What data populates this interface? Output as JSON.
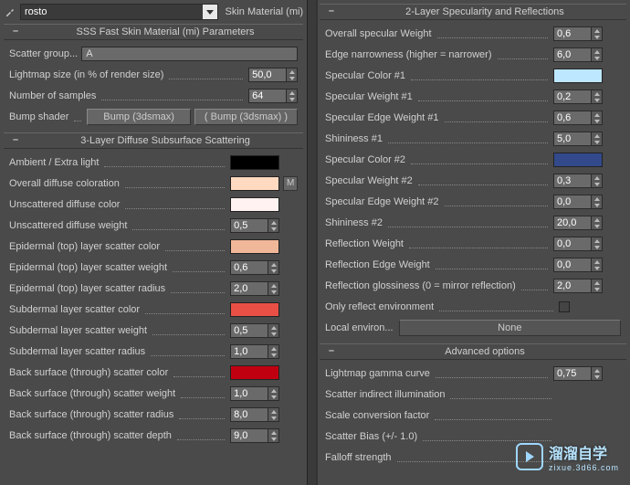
{
  "top": {
    "material_name": "rosto",
    "type_label": "Skin Material (mi)"
  },
  "section1": {
    "title": "SSS Fast Skin Material (mi) Parameters",
    "scatter_group_label": "Scatter group...",
    "scatter_group_value": "A",
    "lightmap_label": "Lightmap size (in % of render size)",
    "lightmap_value": "50,0",
    "samples_label": "Number of samples",
    "samples_value": "64",
    "bump_label": "Bump shader",
    "bump_btn1": "Bump (3dsmax)",
    "bump_btn2": "( Bump (3dsmax) )"
  },
  "section2": {
    "title": "3-Layer Diffuse Subsurface Scattering",
    "ambient_label": "Ambient / Extra light",
    "ambient_color": "#000000",
    "overall_label": "Overall diffuse coloration",
    "overall_color": "#ffd9c0",
    "m_label": "M",
    "unscat_color_label": "Unscattered diffuse color",
    "unscat_color": "#fff2f0",
    "unscat_weight_label": "Unscattered diffuse weight",
    "unscat_weight_value": "0,5",
    "epi_color_label": "Epidermal (top) layer scatter color",
    "epi_color": "#f0b898",
    "epi_weight_label": "Epidermal (top) layer scatter weight",
    "epi_weight_value": "0,6",
    "epi_radius_label": "Epidermal (top) layer scatter radius",
    "epi_radius_value": "2,0",
    "sub_color_label": "Subdermal layer scatter color",
    "sub_color": "#e85045",
    "sub_weight_label": "Subdermal layer scatter weight",
    "sub_weight_value": "0,5",
    "sub_radius_label": "Subdermal layer scatter radius",
    "sub_radius_value": "1,0",
    "back_color_label": "Back surface (through) scatter color",
    "back_color": "#c00010",
    "back_weight_label": "Back surface (through) scatter weight",
    "back_weight_value": "1,0",
    "back_radius_label": "Back surface (through) scatter radius",
    "back_radius_value": "8,0",
    "back_depth_label": "Back surface (through) scatter depth",
    "back_depth_value": "9,0"
  },
  "section3": {
    "title": "2-Layer Specularity and Reflections",
    "spec_weight_label": "Overall specular Weight",
    "spec_weight_value": "0,6",
    "edge_narrow_label": "Edge narrowness (higher = narrower)",
    "edge_narrow_value": "6,0",
    "spec_color1_label": "Specular Color #1",
    "spec_color1": "#bde6ff",
    "spec_weight1_label": "Specular Weight #1",
    "spec_weight1_value": "0,2",
    "spec_edge1_label": "Specular Edge Weight #1",
    "spec_edge1_value": "0,6",
    "shininess1_label": "Shininess #1",
    "shininess1_value": "5,0",
    "spec_color2_label": "Specular Color #2",
    "spec_color2": "#324a8c",
    "spec_weight2_label": "Specular Weight #2",
    "spec_weight2_value": "0,3",
    "spec_edge2_label": "Specular Edge Weight #2",
    "spec_edge2_value": "0,0",
    "shininess2_label": "Shininess #2",
    "shininess2_value": "20,0",
    "refl_weight_label": "Reflection Weight",
    "refl_weight_value": "0,0",
    "refl_edge_label": "Reflection Edge Weight",
    "refl_edge_value": "0,0",
    "refl_gloss_label": "Reflection glossiness (0 = mirror reflection)",
    "refl_gloss_value": "2,0",
    "only_env_label": "Only reflect environment",
    "local_env_label": "Local environ...",
    "local_env_value": "None"
  },
  "section4": {
    "title": "Advanced options",
    "gamma_label": "Lightmap gamma curve",
    "gamma_value": "0,75",
    "scatter_ind_label": "Scatter indirect illumination",
    "scale_conv_label": "Scale conversion factor",
    "scatter_bias_label": "Scatter Bias (+/- 1.0)",
    "falloff_label": "Falloff strength"
  },
  "watermark": {
    "main": "溜溜自学",
    "sub": "zixue.3d66.com"
  }
}
